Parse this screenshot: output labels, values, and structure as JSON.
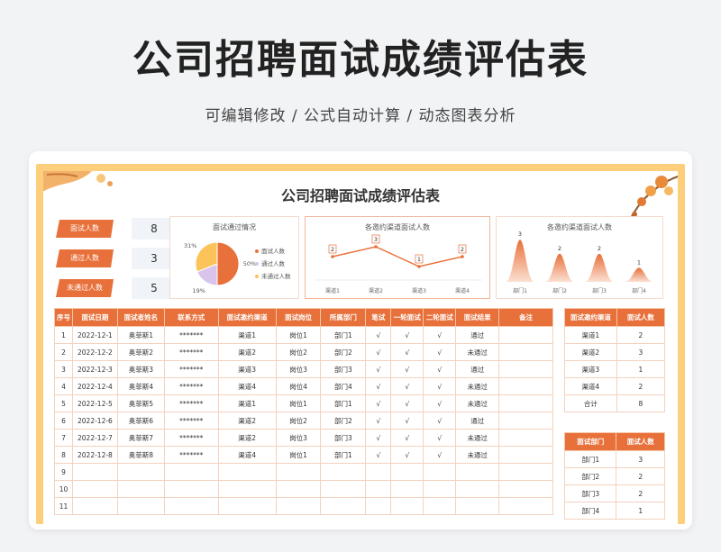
{
  "header": {
    "title": "公司招聘面试成绩评估表",
    "subtitle": "可编辑修改 /  公式自动计算  /  动态图表分析"
  },
  "sheet": {
    "title": "公司招聘面试成绩评估表"
  },
  "stats": [
    {
      "label": "面试人数",
      "value": "8"
    },
    {
      "label": "通过人数",
      "value": "3"
    },
    {
      "label": "未通过人数",
      "value": "5"
    }
  ],
  "colors": {
    "accent": "#e8703a",
    "frame": "#fdcf7d",
    "pie_pass": "#d8c4ec",
    "pie_fail": "#fbc35a"
  },
  "chart_data": [
    {
      "type": "pie",
      "title": "面试通过情况",
      "labels": [
        "面试人数",
        "通过人数",
        "未通过人数"
      ],
      "values": [
        50,
        19,
        31
      ],
      "value_labels": [
        "50%",
        "19%",
        "31%"
      ]
    },
    {
      "type": "line",
      "title": "各邀约渠道面试人数",
      "categories": [
        "渠道1",
        "渠道2",
        "渠道3",
        "渠道4"
      ],
      "values": [
        2,
        3,
        1,
        2
      ],
      "ylim": [
        0,
        4
      ]
    },
    {
      "type": "area",
      "title": "各邀约渠道面试人数",
      "categories": [
        "部门1",
        "部门2",
        "部门3",
        "部门4"
      ],
      "values": [
        3,
        2,
        2,
        1
      ],
      "ylim": [
        0,
        4
      ]
    }
  ],
  "main_table": {
    "headers": [
      "序号",
      "面试日期",
      "面试者姓名",
      "联系方式",
      "面试邀约渠道",
      "面试岗位",
      "所属部门",
      "笔试",
      "一轮面试",
      "二轮面试",
      "面试结果",
      "备注"
    ],
    "rows": [
      [
        "1",
        "2022-12-1",
        "奥菲斯1",
        "*******",
        "渠道1",
        "岗位1",
        "部门1",
        "√",
        "√",
        "√",
        "通过",
        ""
      ],
      [
        "2",
        "2022-12-2",
        "奥菲斯2",
        "*******",
        "渠道2",
        "岗位2",
        "部门2",
        "√",
        "√",
        "√",
        "未通过",
        ""
      ],
      [
        "3",
        "2022-12-3",
        "奥菲斯3",
        "*******",
        "渠道3",
        "岗位3",
        "部门3",
        "√",
        "√",
        "√",
        "通过",
        ""
      ],
      [
        "4",
        "2022-12-4",
        "奥菲斯4",
        "*******",
        "渠道4",
        "岗位4",
        "部门4",
        "√",
        "√",
        "√",
        "未通过",
        ""
      ],
      [
        "5",
        "2022-12-5",
        "奥菲斯5",
        "*******",
        "渠道1",
        "岗位1",
        "部门1",
        "√",
        "√",
        "√",
        "未通过",
        ""
      ],
      [
        "6",
        "2022-12-6",
        "奥菲斯6",
        "*******",
        "渠道2",
        "岗位2",
        "部门2",
        "√",
        "√",
        "√",
        "通过",
        ""
      ],
      [
        "7",
        "2022-12-7",
        "奥菲斯7",
        "*******",
        "渠道2",
        "岗位3",
        "部门3",
        "√",
        "√",
        "√",
        "未通过",
        ""
      ],
      [
        "8",
        "2022-12-8",
        "奥菲斯8",
        "*******",
        "渠道4",
        "岗位1",
        "部门1",
        "√",
        "√",
        "√",
        "未通过",
        ""
      ],
      [
        "9",
        "",
        "",
        "",
        "",
        "",
        "",
        "",
        "",
        "",
        "",
        ""
      ],
      [
        "10",
        "",
        "",
        "",
        "",
        "",
        "",
        "",
        "",
        "",
        "",
        ""
      ],
      [
        "11",
        "",
        "",
        "",
        "",
        "",
        "",
        "",
        "",
        "",
        "",
        ""
      ]
    ]
  },
  "channel_table": {
    "headers": [
      "面试邀约渠道",
      "面试人数"
    ],
    "rows": [
      [
        "渠道1",
        "2"
      ],
      [
        "渠道2",
        "3"
      ],
      [
        "渠道3",
        "1"
      ],
      [
        "渠道4",
        "2"
      ],
      [
        "合计",
        "8"
      ]
    ]
  },
  "dept_table": {
    "headers": [
      "面试部门",
      "面试人数"
    ],
    "rows": [
      [
        "部门1",
        "3"
      ],
      [
        "部门2",
        "2"
      ],
      [
        "部门3",
        "2"
      ],
      [
        "部门4",
        "1"
      ]
    ]
  }
}
